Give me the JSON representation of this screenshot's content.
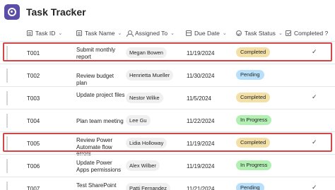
{
  "app": {
    "title": "Task Tracker",
    "star_glyph": "☆",
    "icon": "app-logo-icon",
    "brand_color": "#5b4ea8"
  },
  "columns": [
    {
      "label": "Task ID",
      "icon": "text-column-icon"
    },
    {
      "label": "Task Name",
      "icon": "text-column-icon"
    },
    {
      "label": "Assigned To",
      "icon": "person-column-icon"
    },
    {
      "label": "Due Date",
      "icon": "calendar-column-icon"
    },
    {
      "label": "Task Status",
      "icon": "choice-column-icon"
    },
    {
      "label": "Completed ?",
      "icon": "boolean-column-icon"
    }
  ],
  "chevron": "⌄",
  "status_colors": {
    "Completed": "#f3e0a6",
    "Pending": "#b9e0fb",
    "In Progress": "#b2efb2"
  },
  "highlight_color": "#d64545",
  "rows": [
    {
      "id": "T001",
      "name": "Submit monthly report",
      "assigned": "Megan Bowen",
      "due": "11/19/2024",
      "status": "Completed",
      "completed": "✓",
      "highlighted": true
    },
    {
      "id": "T002",
      "name": "Review budget plan",
      "assigned": "Henrietta Mueller",
      "due": "11/30/2024",
      "status": "Pending",
      "completed": "",
      "highlighted": false
    },
    {
      "id": "T003",
      "name": "Update project files",
      "assigned": "Nestor Wilke",
      "due": "11/5/2024",
      "status": "Completed",
      "completed": "✓",
      "highlighted": false
    },
    {
      "id": "T004",
      "name": "Plan team meeting",
      "assigned": "Lee Gu",
      "due": "11/22/2024",
      "status": "In Progress",
      "completed": "",
      "highlighted": false
    },
    {
      "id": "T005",
      "name": "Review Power Automate flow errors",
      "assigned": "Lidia Holloway",
      "due": "11/19/2024",
      "status": "Completed",
      "completed": "✓",
      "highlighted": true
    },
    {
      "id": "T006",
      "name": "Update Power Apps permissions",
      "assigned": "Alex Wilber",
      "due": "11/19/2024",
      "status": "In Progress",
      "completed": "",
      "highlighted": false
    },
    {
      "id": "T007",
      "name": "Test SharePoint integration in flow",
      "assigned": "Patti Fernandez",
      "due": "11/21/2024",
      "status": "Pending",
      "completed": "✓",
      "highlighted": false
    }
  ]
}
